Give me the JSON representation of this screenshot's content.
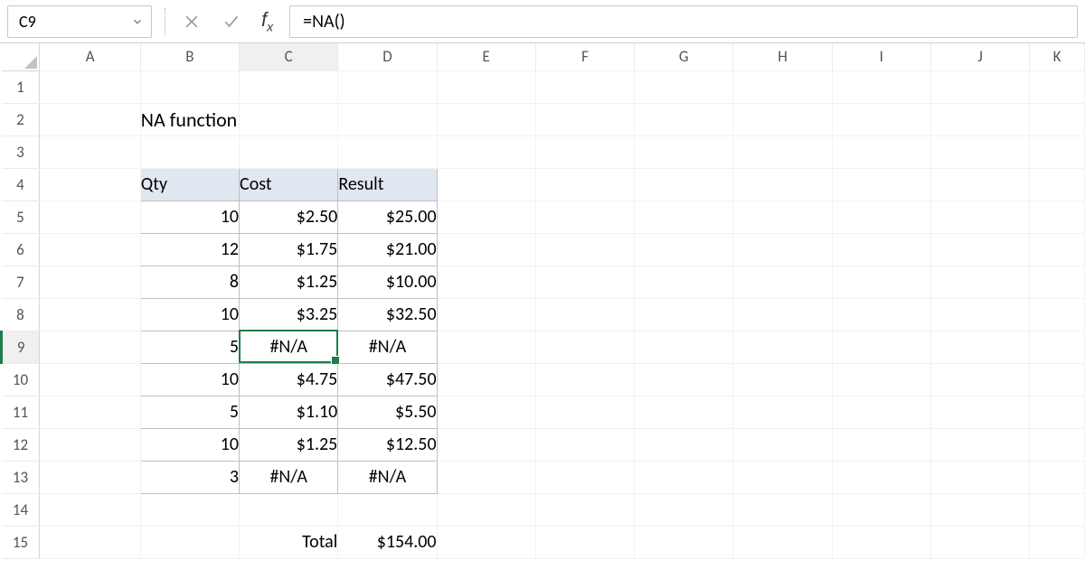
{
  "name_box": "C9",
  "formula": "=NA()",
  "columns": [
    "A",
    "B",
    "C",
    "D",
    "E",
    "F",
    "G",
    "H",
    "I",
    "J",
    "K"
  ],
  "rows": [
    "1",
    "2",
    "3",
    "4",
    "5",
    "6",
    "7",
    "8",
    "9",
    "10",
    "11",
    "12",
    "13",
    "14",
    "15"
  ],
  "title": "NA function",
  "headers": {
    "qty": "Qty",
    "cost": "Cost",
    "result": "Result"
  },
  "data": [
    {
      "qty": "10",
      "cost": "$2.50",
      "result": "$25.00"
    },
    {
      "qty": "12",
      "cost": "$1.75",
      "result": "$21.00"
    },
    {
      "qty": "8",
      "cost": "$1.25",
      "result": "$10.00"
    },
    {
      "qty": "10",
      "cost": "$3.25",
      "result": "$32.50"
    },
    {
      "qty": "5",
      "cost": "#N/A",
      "result": "#N/A"
    },
    {
      "qty": "10",
      "cost": "$4.75",
      "result": "$47.50"
    },
    {
      "qty": "5",
      "cost": "$1.10",
      "result": "$5.50"
    },
    {
      "qty": "10",
      "cost": "$1.25",
      "result": "$12.50"
    },
    {
      "qty": "3",
      "cost": "#N/A",
      "result": "#N/A"
    }
  ],
  "total_label": "Total",
  "total_value": "$154.00",
  "selected_col_index": 2,
  "selected_row_index": 8
}
